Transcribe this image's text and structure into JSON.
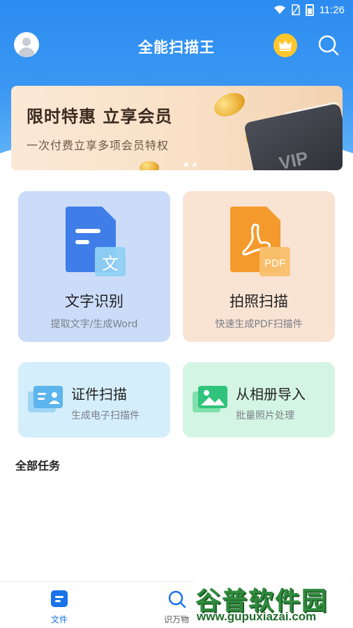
{
  "status_bar": {
    "time": "11:26"
  },
  "header": {
    "title": "全能扫描王"
  },
  "banner": {
    "title": "限时特惠 立享会员",
    "subtitle": "一次付费立享多项会员特权",
    "card_text": "VIP"
  },
  "features": [
    {
      "label": "文字识别",
      "desc": "提取文字/生成Word",
      "icon_text": "文"
    },
    {
      "label": "拍照扫描",
      "desc": "快速生成PDF扫描件",
      "icon_text": "PDF"
    },
    {
      "label": "证件扫描",
      "desc": "生成电子扫描件"
    },
    {
      "label": "从相册导入",
      "desc": "批量照片处理"
    }
  ],
  "section": {
    "title": "全部任务"
  },
  "bottom_nav": [
    {
      "label": "文件"
    },
    {
      "label": "识万物"
    }
  ],
  "watermark": {
    "title": "谷普软件园",
    "url": "www.gupuxiazai.com"
  },
  "colors": {
    "primary": "#2d8cf0",
    "ocr_card": "#cbdcf9",
    "scan_card": "#f9e3d3",
    "id_card": "#d4eefb",
    "album_card": "#d4f5e4",
    "crown": "#ffc72c"
  }
}
